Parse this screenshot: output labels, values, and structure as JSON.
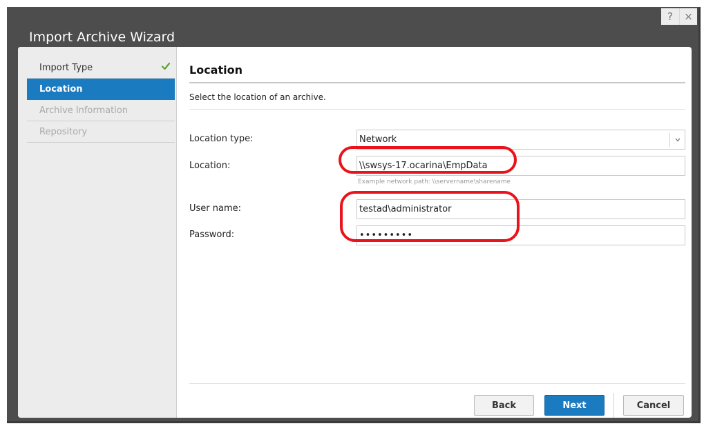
{
  "window": {
    "title": "Import Archive Wizard",
    "help_icon": "?",
    "close_icon": "×"
  },
  "sidebar": {
    "items": [
      {
        "label": "Import Type",
        "state": "completed"
      },
      {
        "label": "Location",
        "state": "active"
      },
      {
        "label": "Archive Information",
        "state": "disabled"
      },
      {
        "label": "Repository",
        "state": "disabled"
      }
    ]
  },
  "page": {
    "heading": "Location",
    "description": "Select the location of an archive."
  },
  "form": {
    "location_type": {
      "label": "Location type:",
      "value": "Network"
    },
    "location": {
      "label": "Location:",
      "value": "\\\\swsys-17.ocarina\\EmpData",
      "hint": "Example network path: \\\\servername\\sharename"
    },
    "user_name": {
      "label": "User name:",
      "value": "testad\\administrator"
    },
    "password": {
      "label": "Password:",
      "value": "•••••••••"
    }
  },
  "buttons": {
    "back": "Back",
    "next": "Next",
    "cancel": "Cancel"
  },
  "colors": {
    "accent": "#1b7bc0",
    "annotation": "#e8131b",
    "check": "#5aa52f"
  }
}
